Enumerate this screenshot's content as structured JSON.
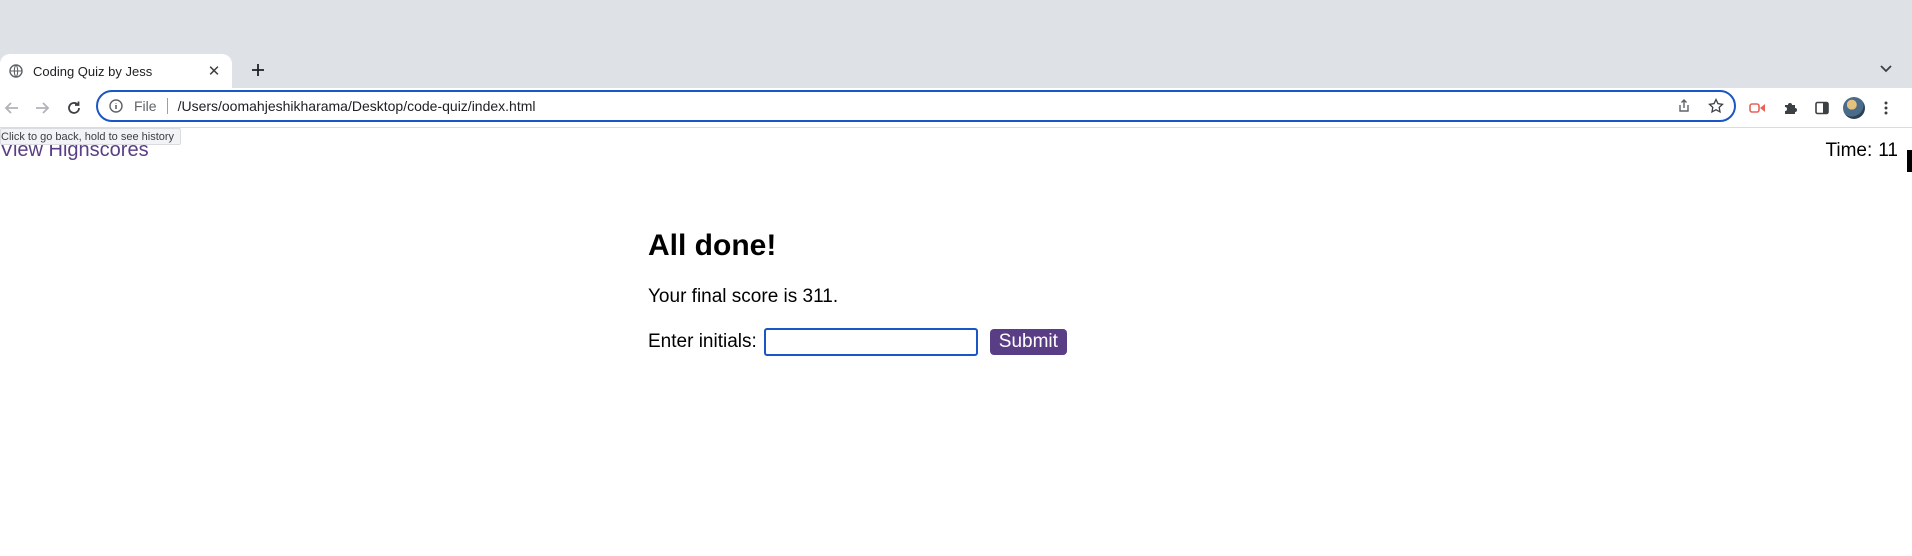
{
  "browser": {
    "tab": {
      "title": "Coding Quiz by Jess",
      "icon": "globe-icon"
    },
    "new_tab_icon": "plus-icon",
    "address": {
      "scheme": "File",
      "url": "/Users/oomahjeshikharama/Desktop/code-quiz/index.html"
    },
    "tooltip": "Click to go back, hold to see history"
  },
  "page": {
    "view_highscores": "View Highscores",
    "timer": {
      "label": "Time:",
      "value": "11"
    },
    "heading": "All done!",
    "final_score_text": "Your final score is 311.",
    "initials_label": "Enter initials:",
    "initials_value": "",
    "submit_label": "Submit",
    "accent_color": "#5a3e85"
  }
}
